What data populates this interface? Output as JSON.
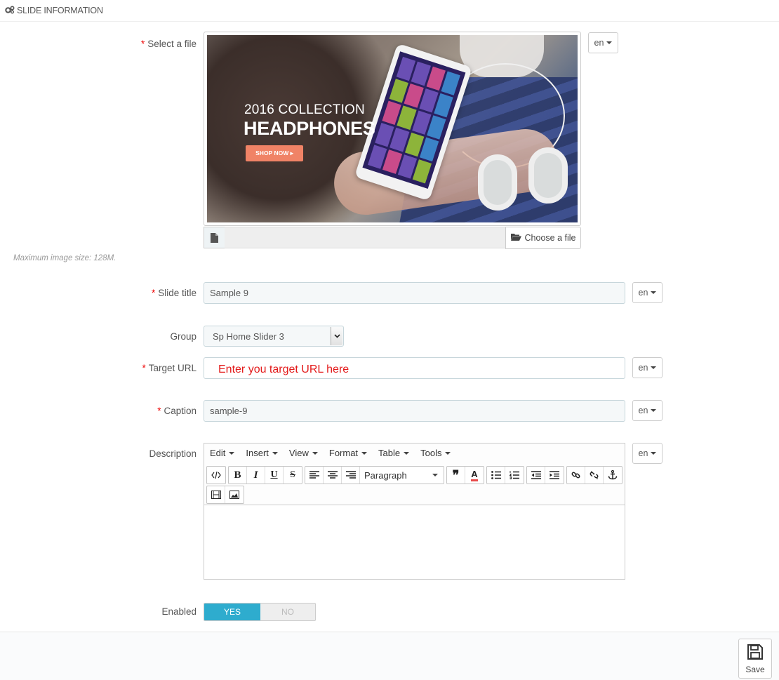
{
  "panel": {
    "heading": "SLIDE INFORMATION"
  },
  "fields": {
    "file": {
      "label": "Select a file",
      "lang": "en",
      "choose_label": "Choose a file",
      "help": "Maximum image size: 128M."
    },
    "title": {
      "label": "Slide title",
      "value": "Sample 9",
      "lang": "en"
    },
    "group": {
      "label": "Group",
      "selected": "Sp Home Slider 3"
    },
    "url": {
      "label": "Target URL",
      "value": "",
      "lang": "en",
      "annotation": "Enter you target URL here"
    },
    "caption": {
      "label": "Caption",
      "value": "sample-9",
      "lang": "en"
    },
    "description": {
      "label": "Description",
      "lang": "en",
      "menus": [
        "Edit",
        "Insert",
        "View",
        "Format",
        "Table",
        "Tools"
      ],
      "format_select": "Paragraph"
    },
    "enabled": {
      "label": "Enabled",
      "yes": "YES",
      "no": "NO",
      "value": "YES"
    }
  },
  "slide_image": {
    "line1": "2016 COLLECTION",
    "line2": "HEADPHONES",
    "button": "SHOP NOW ▸"
  },
  "footer": {
    "save_label": "Save"
  },
  "colors": {
    "required": "#e00000",
    "toggle_on": "#2eacce",
    "annotation": "#e31b1b"
  }
}
